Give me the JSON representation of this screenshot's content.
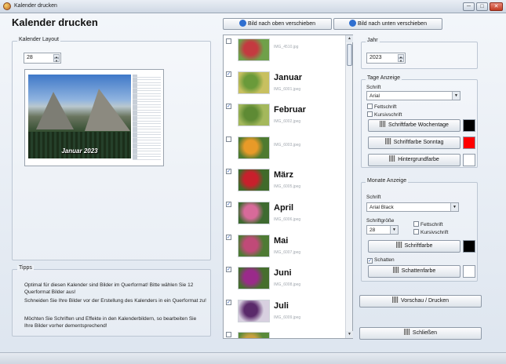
{
  "window": {
    "title": "Kalender drucken",
    "minimize": "─",
    "maximize": "□",
    "close": "✕"
  },
  "heading": "Kalender drucken",
  "layout": {
    "group_label": "Kalender Layout",
    "size_value": "28",
    "caption": "Januar 2023"
  },
  "tips": {
    "group_label": "Tipps",
    "lines": [
      "Optimal für diesen Kalender sind Bilder im Querformat! Bitte wählen Sie 12 Querformat Bilder aus!",
      "Schneiden Sie Ihre Bilder vor der Erstellung des Kalenders in ein Querformat zu!",
      "Möchten Sie Schriften und Effekte in den Kalenderbildern, so bearbeiten Sie Ihre Bilder vorher dementsprechend!"
    ]
  },
  "toolbar": {
    "move_up": "Bild nach oben verschieben",
    "move_down": "Bild nach unten verschieben"
  },
  "images": [
    {
      "checked": false,
      "month": "",
      "file": "IMG_4510.jpg",
      "colors": [
        "#c43a40",
        "#6fa04a"
      ]
    },
    {
      "checked": true,
      "month": "Januar",
      "file": "IMG_6001.jpeg",
      "colors": [
        "#6a9a3a",
        "#c8c060"
      ]
    },
    {
      "checked": true,
      "month": "Februar",
      "file": "IMG_6002.jpeg",
      "colors": [
        "#5e8a34",
        "#a4b85c"
      ]
    },
    {
      "checked": false,
      "month": "",
      "file": "IMG_6003.jpeg",
      "colors": [
        "#e89a28",
        "#4e7a30"
      ]
    },
    {
      "checked": true,
      "month": "März",
      "file": "IMG_6005.jpeg",
      "colors": [
        "#c8202c",
        "#406a2a"
      ]
    },
    {
      "checked": true,
      "month": "April",
      "file": "IMG_6006.jpeg",
      "colors": [
        "#d86a9a",
        "#3e6a30"
      ]
    },
    {
      "checked": true,
      "month": "Mai",
      "file": "IMG_6007.jpeg",
      "colors": [
        "#c04a78",
        "#4e7a34"
      ]
    },
    {
      "checked": true,
      "month": "Juni",
      "file": "IMG_6008.jpeg",
      "colors": [
        "#9a2a8a",
        "#466e2e"
      ]
    },
    {
      "checked": true,
      "month": "Juli",
      "file": "IMG_6009.jpeg",
      "colors": [
        "#5a2a6a",
        "#d8d0e0"
      ]
    },
    {
      "checked": false,
      "month": "",
      "file": "",
      "colors": [
        "#c8a040",
        "#5a8a3a"
      ]
    }
  ],
  "year": {
    "group_label": "Jahr",
    "value": "2023"
  },
  "days": {
    "group_label": "Tage Anzeige",
    "font_label": "Schrift",
    "font_value": "Arial",
    "bold_label": "Fettschrift",
    "italic_label": "Kursivschrift",
    "color_weekday_btn": "Schriftfarbe Wochentage",
    "color_sunday_btn": "Schriftfarbe Sonntag",
    "background_btn": "Hintergrundfarbe",
    "weekday_color": "#000000",
    "sunday_color": "#ff0000",
    "background_color": "#ffffff"
  },
  "months": {
    "group_label": "Monate Anzeige",
    "font_label": "Schrift",
    "font_value": "Arial Black",
    "size_label": "Schriftgröße",
    "size_value": "28",
    "bold_label": "Fettschrift",
    "italic_label": "Kursivschrift",
    "color_btn": "Schriftfarbe",
    "font_color": "#000000",
    "shadow_label": "Schatten",
    "shadow_checked": true,
    "shadow_color_btn": "Schattenfarbe",
    "shadow_color": "#ffffff"
  },
  "actions": {
    "preview_print": "Vorschau / Drucken",
    "close": "Schließen"
  }
}
